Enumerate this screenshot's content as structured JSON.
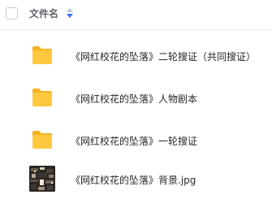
{
  "header": {
    "column_label": "文件名"
  },
  "icons": {
    "folder": "folder-icon",
    "image": "image-thumbnail-icon",
    "sort": "sort-icon"
  },
  "colors": {
    "folder_body": "#FFC83D",
    "folder_tab": "#F5B324",
    "sort_active": "#3370FF",
    "sort_inactive": "#B9C3D6"
  },
  "files": [
    {
      "name": "《网红校花的坠落》二轮搜证（共同搜证）",
      "type": "folder"
    },
    {
      "name": "《网红校花的坠落》人物剧本",
      "type": "folder"
    },
    {
      "name": "《网红校花的坠落》一轮搜证",
      "type": "folder"
    },
    {
      "name": "《网红校花的坠落》背景.jpg",
      "type": "image"
    }
  ]
}
